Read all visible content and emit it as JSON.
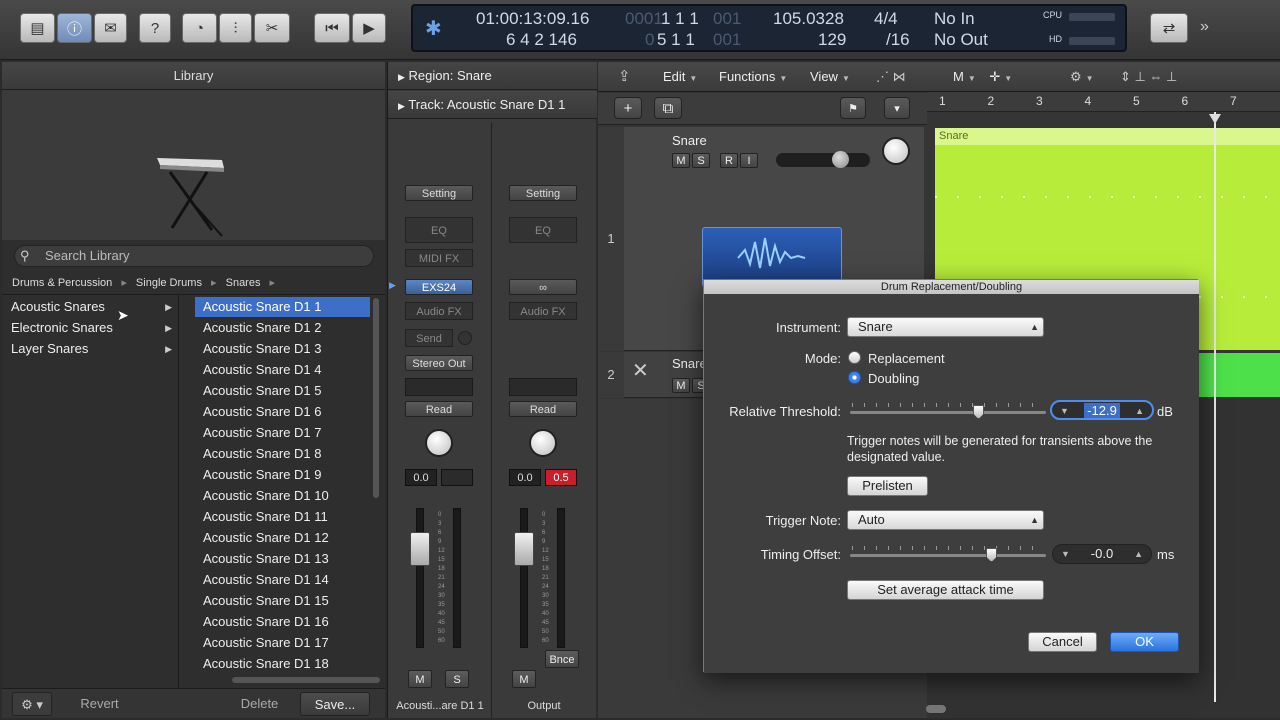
{
  "toolbar": {
    "icons": [
      "library-icon",
      "info-icon",
      "editor-icon",
      "help-icon",
      "smart-controls-icon",
      "mixer-icon",
      "scissors-icon",
      "rewind-icon",
      "play-icon",
      "settings-gear-icon",
      "cycle-icon",
      "more-icon"
    ]
  },
  "lcd": {
    "position_time": "01:00:13:09.16",
    "position_time_dim": "00",
    "position_bars": "6 4 2 146",
    "bar_top_dim": "0001",
    "bar_top": "1 1 1",
    "bar_top_dim2": "001",
    "bar_bottom_dim": "0",
    "bar_bottom": "5 1 1",
    "bar_bottom_dim2": "001",
    "tempo": "105.0328",
    "tempo_bottom": "129",
    "signature": "4/4",
    "division": "/16",
    "midi_in": "No In",
    "midi_out": "No Out",
    "cpu_label": "CPU",
    "hd_label": "HD"
  },
  "library": {
    "title": "Library",
    "search_placeholder": "Search Library",
    "breadcrumb": [
      "Drums & Percussion",
      "Single Drums",
      "Snares"
    ],
    "categories": [
      "Acoustic Snares",
      "Electronic Snares",
      "Layer Snares"
    ],
    "patches": [
      "Acoustic Snare D1 1",
      "Acoustic Snare D1 2",
      "Acoustic Snare D1 3",
      "Acoustic Snare D1 4",
      "Acoustic Snare D1 5",
      "Acoustic Snare D1 6",
      "Acoustic Snare D1 7",
      "Acoustic Snare D1 8",
      "Acoustic Snare D1 9",
      "Acoustic Snare D1 10",
      "Acoustic Snare D1 11",
      "Acoustic Snare D1 12",
      "Acoustic Snare D1 13",
      "Acoustic Snare D1 14",
      "Acoustic Snare D1 15",
      "Acoustic Snare D1 16",
      "Acoustic Snare D1 17",
      "Acoustic Snare D1 18"
    ],
    "footer": {
      "revert": "Revert",
      "delete": "Delete",
      "save": "Save..."
    }
  },
  "inspector": {
    "region_label": "Region:",
    "region_name": "Snare",
    "track_label": "Track:",
    "track_name": "Acoustic Snare D1 1",
    "strip1": {
      "setting": "Setting",
      "eq": "EQ",
      "midi_fx": "MIDI FX",
      "instrument": "EXS24",
      "audio_fx": "Audio FX",
      "send": "Send",
      "output": "Stereo Out",
      "automation": "Read",
      "volume": "0.0",
      "peak": "",
      "mute": "M",
      "solo": "S",
      "name": "Acousti...are D1 1"
    },
    "strip2": {
      "setting": "Setting",
      "eq": "EQ",
      "link": "∞",
      "audio_fx": "Audio FX",
      "automation": "Read",
      "volume": "0.0",
      "peak": "0.5",
      "mute": "M",
      "bounce": "Bnce",
      "name": "Output"
    },
    "meter_scale": [
      "0",
      "3",
      "6",
      "9",
      "12",
      "15",
      "18",
      "21",
      "24",
      "30",
      "35",
      "40",
      "45",
      "50",
      "60"
    ]
  },
  "main": {
    "menus": [
      "Edit",
      "Functions",
      "View"
    ],
    "tool_m": "M",
    "ruler": [
      "1",
      "2",
      "3",
      "4",
      "5",
      "6",
      "7"
    ],
    "track1": {
      "number": "1",
      "name": "Snare",
      "buttons": [
        "M",
        "S",
        "R",
        "I"
      ],
      "region_name": "Snare"
    },
    "track2": {
      "number": "2",
      "name": "Snare",
      "buttons": [
        "M",
        "S"
      ]
    }
  },
  "dialog": {
    "title": "Drum Replacement/Doubling",
    "instrument_label": "Instrument:",
    "instrument_value": "Snare",
    "mode_label": "Mode:",
    "mode_options": [
      "Replacement",
      "Doubling"
    ],
    "mode_selected": "Doubling",
    "threshold_label": "Relative Threshold:",
    "threshold_value": "-12.9",
    "threshold_unit": "dB",
    "hint": "Trigger notes will be generated for transients above the designated value.",
    "prelisten": "Prelisten",
    "trigger_label": "Trigger Note:",
    "trigger_value": "Auto",
    "timing_label": "Timing Offset:",
    "timing_value": "-0.0",
    "timing_unit": "ms",
    "set_attack": "Set average attack time",
    "cancel": "Cancel",
    "ok": "OK"
  }
}
